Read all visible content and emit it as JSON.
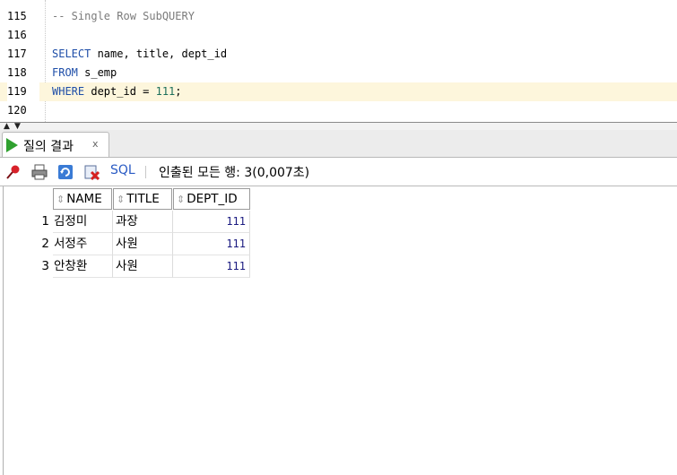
{
  "editor": {
    "lines": [
      {
        "num": "115",
        "segments": [
          {
            "text": "-- Single Row SubQUERY",
            "cls": "cmt"
          }
        ]
      },
      {
        "num": "116",
        "segments": []
      },
      {
        "num": "117",
        "segments": [
          {
            "text": "SELECT",
            "cls": "kw"
          },
          {
            "text": " name, title, dept_id",
            "cls": ""
          }
        ]
      },
      {
        "num": "118",
        "segments": [
          {
            "text": "FROM",
            "cls": "kw"
          },
          {
            "text": " s_emp",
            "cls": ""
          }
        ]
      },
      {
        "num": "119",
        "segments": [
          {
            "text": "WHERE",
            "cls": "kw"
          },
          {
            "text": " dept_id = ",
            "cls": ""
          },
          {
            "text": "111",
            "cls": "nm"
          },
          {
            "text": ";",
            "cls": ""
          }
        ],
        "current": true
      },
      {
        "num": "120",
        "segments": []
      }
    ]
  },
  "result_tab": {
    "label": "질의 결과",
    "close": "x"
  },
  "toolbar": {
    "sql_label": "SQL",
    "status": "인출된 모든 행: 3(0,007초)"
  },
  "grid": {
    "columns": [
      "NAME",
      "TITLE",
      "DEPT_ID"
    ],
    "rows": [
      {
        "num": "1",
        "name": "김정미",
        "title": "과장",
        "dept_id": "111"
      },
      {
        "num": "2",
        "name": "서정주",
        "title": "사원",
        "dept_id": "111"
      },
      {
        "num": "3",
        "name": "안창환",
        "title": "사원",
        "dept_id": "111"
      }
    ]
  },
  "colors": {
    "keyword": "#1e4ea8",
    "comment": "#7b7b7b",
    "number": "#1c6f5a",
    "current_line": "#fdf6dc",
    "run_icon": "#2fa02f"
  }
}
